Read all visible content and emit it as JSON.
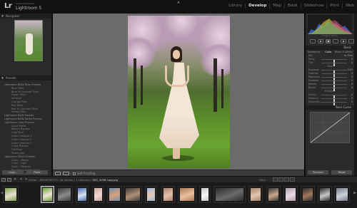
{
  "app": {
    "logo": "Lr",
    "brand_small": "Adobe Photoshop",
    "brand_large": "Lightroom 5"
  },
  "modules": [
    {
      "label": "Library",
      "active": false
    },
    {
      "label": "Develop",
      "active": true
    },
    {
      "label": "Map",
      "active": false
    },
    {
      "label": "Book",
      "active": false
    },
    {
      "label": "Slideshow",
      "active": false
    },
    {
      "label": "Print",
      "active": false
    },
    {
      "label": "Web",
      "active": false
    }
  ],
  "left_panel": {
    "navigator_label": "Navigator",
    "presets_label": "Presets",
    "presets": [
      {
        "label": "Lightroom B&W Filter Presets",
        "child": false
      },
      {
        "label": "Blue Filter",
        "child": true
      },
      {
        "label": "Blue Hi-Contrast Filter",
        "child": true
      },
      {
        "label": "Green Filter",
        "child": true
      },
      {
        "label": "Infrared",
        "child": true
      },
      {
        "label": "Orange Filter",
        "child": true
      },
      {
        "label": "Red Filter",
        "child": true
      },
      {
        "label": "Red Hi-Contrast Filter",
        "child": true
      },
      {
        "label": "Yellow Filter",
        "child": true
      },
      {
        "label": "Lightroom B&W Presets",
        "child": false
      },
      {
        "label": "Lightroom B&W Toned Presets",
        "child": false
      },
      {
        "label": "Lightroom Color Presets",
        "child": false
      },
      {
        "label": "Aged Photo",
        "child": true
      },
      {
        "label": "Bleach Bypass",
        "child": true
      },
      {
        "label": "Cold Tone",
        "child": true
      },
      {
        "label": "Color Creative 1",
        "child": true
      },
      {
        "label": "Color Creative 2",
        "child": true
      },
      {
        "label": "Color Creative 3",
        "child": true
      },
      {
        "label": "Cross Process",
        "child": true
      },
      {
        "label": "Old Polar",
        "child": true
      },
      {
        "label": "Yesteryear",
        "child": true
      },
      {
        "label": "Lightroom Effect Presets",
        "child": false
      },
      {
        "label": "Grain - Heavy",
        "child": true
      },
      {
        "label": "Grain - Light",
        "child": true
      },
      {
        "label": "Grain - Medium",
        "child": true
      },
      {
        "label": "Rounded Corners Black",
        "child": true
      },
      {
        "label": "Rounded Corners White",
        "child": true
      },
      {
        "label": "Vignette 1",
        "child": true
      }
    ],
    "copy_button": "Copy...",
    "paste_button": "Paste"
  },
  "toolbar": {
    "soft_proofing": "Soft Proofing"
  },
  "right_panel": {
    "histogram_info": "Original Photo",
    "basic_label": "Basic",
    "treatment": [
      "Treatment :",
      "Color",
      "Black & White"
    ],
    "wb_label": "WB :",
    "wb_value": "As Shot",
    "sliders": [
      {
        "label": "Temp",
        "value": "0",
        "level": 0.5
      },
      {
        "label": "Tint",
        "value": "0",
        "level": 0.5
      },
      {
        "label": "Exposure",
        "value": "0.00",
        "level": 0.5
      },
      {
        "label": "Contrast",
        "value": "0",
        "level": 0.5
      },
      {
        "label": "Highlights",
        "value": "0",
        "level": 0.5
      },
      {
        "label": "Shadows",
        "value": "0",
        "level": 0.5
      },
      {
        "label": "Whites",
        "value": "0",
        "level": 0.5
      },
      {
        "label": "Blacks",
        "value": "0",
        "level": 0.5
      },
      {
        "label": "Clarity",
        "value": "0",
        "level": 0.5
      },
      {
        "label": "Vibrance",
        "value": "0",
        "level": 0.5
      },
      {
        "label": "Saturation",
        "value": "0",
        "level": 0.5
      }
    ],
    "tone_label": "Tone",
    "auto_label": "Auto",
    "presence_label": "Presence",
    "tone_curve_label": "Tone Curve",
    "previous_button": "Previous",
    "reset_button": "Reset"
  },
  "filmstrip_header": {
    "folder": "Folder : ANGIEPHOTO-",
    "count": "26 photos / 1 selected /",
    "filename": "IMG_4098 copy.jpg",
    "filter_label": "Filter :"
  },
  "filmstrip": {
    "thumbs": [
      {
        "color1": "#7aa04a",
        "color2": "#e8e0d0",
        "selected": false
      },
      {
        "color1": "#6aa33a",
        "color2": "#f0e6d6",
        "selected": true
      },
      {
        "color1": "#3a3a3a",
        "color2": "#8a8a8a",
        "selected": false
      },
      {
        "color1": "#4b6fb0",
        "color2": "#d6e0f2",
        "selected": false
      },
      {
        "color1": "#c9a6a0",
        "color2": "#f2d6d0",
        "selected": false
      },
      {
        "color1": "#6f8fb0",
        "color2": "#d9a07a",
        "selected": false
      },
      {
        "color1": "#3d3a38",
        "color2": "#b08f78",
        "selected": false
      },
      {
        "color1": "#a0b8d8",
        "color2": "#e8c8b8",
        "selected": false
      },
      {
        "color1": "#b08070",
        "color2": "#e0c0a8",
        "selected": false
      },
      {
        "color1": "#a87858",
        "color2": "#e8c0a0",
        "selected": false
      },
      {
        "color1": "#c8c8c8",
        "color2": "#f4f4f4",
        "selected": false
      },
      {
        "color1": "#2c2c2c",
        "color2": "#6a6a6a",
        "selected": false
      },
      {
        "color1": "#a88068",
        "color2": "#e0c8b0",
        "selected": false
      },
      {
        "color1": "#3a3632",
        "color2": "#c8a890",
        "selected": false
      },
      {
        "color1": "#b0a0a8",
        "color2": "#e8dce4",
        "selected": false
      },
      {
        "color1": "#2e2a28",
        "color2": "#a07860",
        "selected": false
      },
      {
        "color1": "#282828",
        "color2": "#c8c8c8",
        "selected": false
      },
      {
        "color1": "#707888",
        "color2": "#d0d0d8",
        "selected": false
      }
    ]
  }
}
